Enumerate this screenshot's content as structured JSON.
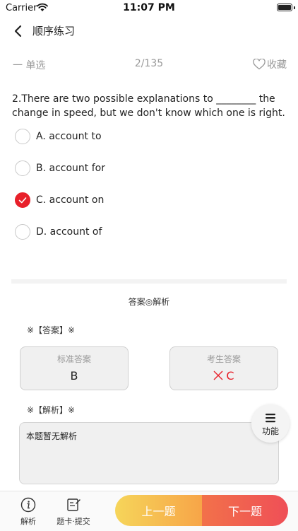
{
  "status": {
    "carrier": "Carrier",
    "time": "11:07 PM"
  },
  "nav": {
    "title": "顺序练习"
  },
  "subheader": {
    "type": "一 单选",
    "progress": "2/135",
    "favorite": "收藏"
  },
  "question": {
    "text": "2.There are two possible explanations to ________ the change in speed, but we don't know which one is right."
  },
  "options": [
    {
      "label": "A. account to",
      "selected": false
    },
    {
      "label": "B. account for",
      "selected": false
    },
    {
      "label": "C. account on",
      "selected": true
    },
    {
      "label": "D. account of",
      "selected": false
    }
  ],
  "answer_section": {
    "heading": "答案◎解析",
    "answer_label": "※【答案】※",
    "standard_caption": "标准答案",
    "standard_value": "B",
    "student_caption": "考生答案",
    "student_value": "C",
    "analysis_label": "※【解析】※",
    "analysis_text": "本题暂无解析"
  },
  "function_button": {
    "label": "功能"
  },
  "bottom_bar": {
    "analysis": "解析",
    "card_submit": "题卡·提交",
    "prev": "上一题",
    "next": "下一题"
  },
  "colors": {
    "accent_red": "#e8202a",
    "prev_gradient": "#f6d55a",
    "next_gradient": "#ef4f57"
  }
}
